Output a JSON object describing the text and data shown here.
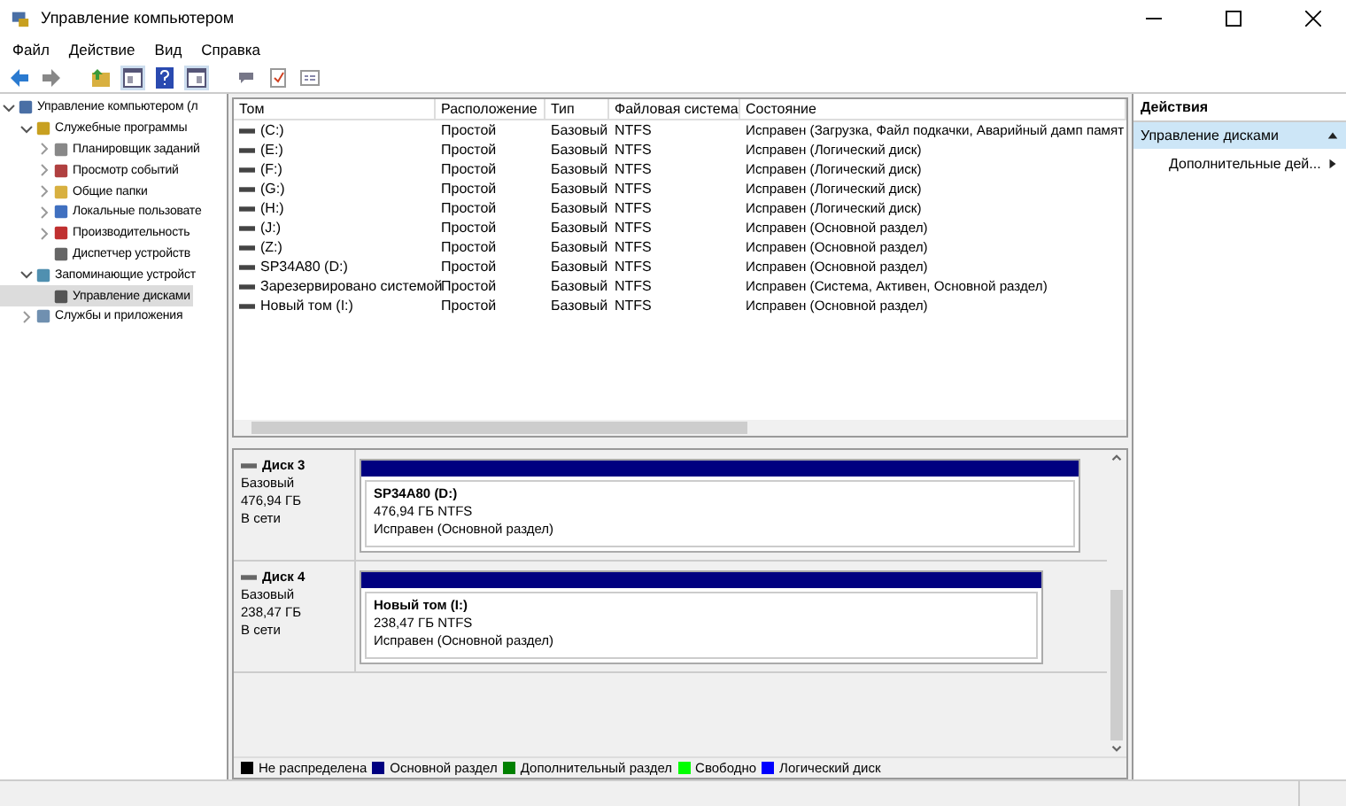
{
  "window": {
    "title": "Управление компьютером"
  },
  "menu": [
    "Файл",
    "Действие",
    "Вид",
    "Справка"
  ],
  "tree": [
    {
      "label": "Управление компьютером (л",
      "selected": false,
      "expanded": true,
      "children": [
        {
          "label": "Служебные программы",
          "selected": false,
          "expanded": true,
          "children": [
            {
              "label": "Планировщик заданий",
              "selected": false,
              "expanded": false
            },
            {
              "label": "Просмотр событий",
              "selected": false,
              "expanded": false
            },
            {
              "label": "Общие папки",
              "selected": false,
              "expanded": false
            },
            {
              "label": "Локальные пользовате",
              "selected": false,
              "expanded": false
            },
            {
              "label": "Производительность",
              "selected": false,
              "expanded": false
            },
            {
              "label": "Диспетчер устройств",
              "selected": false
            }
          ]
        },
        {
          "label": "Запоминающие устройст",
          "selected": false,
          "expanded": true,
          "children": [
            {
              "label": "Управление дисками",
              "selected": true
            }
          ]
        },
        {
          "label": "Службы и приложения",
          "selected": false,
          "expanded": false
        }
      ]
    }
  ],
  "table": {
    "columns": [
      "Том",
      "Расположение",
      "Тип",
      "Файловая система",
      "Состояние"
    ],
    "rows": [
      [
        "(C:)",
        "Простой",
        "Базовый",
        "NTFS",
        "Исправен (Загрузка, Файл подкачки, Аварийный дамп памят"
      ],
      [
        "(E:)",
        "Простой",
        "Базовый",
        "NTFS",
        "Исправен (Логический диск)"
      ],
      [
        "(F:)",
        "Простой",
        "Базовый",
        "NTFS",
        "Исправен (Логический диск)"
      ],
      [
        "(G:)",
        "Простой",
        "Базовый",
        "NTFS",
        "Исправен (Логический диск)"
      ],
      [
        "(H:)",
        "Простой",
        "Базовый",
        "NTFS",
        "Исправен (Логический диск)"
      ],
      [
        "(J:)",
        "Простой",
        "Базовый",
        "NTFS",
        "Исправен (Основной раздел)"
      ],
      [
        "(Z:)",
        "Простой",
        "Базовый",
        "NTFS",
        "Исправен (Основной раздел)"
      ],
      [
        "SP34A80 (D:)",
        "Простой",
        "Базовый",
        "NTFS",
        "Исправен (Основной раздел)"
      ],
      [
        "Зарезервировано системой",
        "Простой",
        "Базовый",
        "NTFS",
        "Исправен (Система, Активен, Основной раздел)"
      ],
      [
        "Новый том (I:)",
        "Простой",
        "Базовый",
        "NTFS",
        "Исправен (Основной раздел)"
      ]
    ]
  },
  "disks": [
    {
      "name": "Диск 3",
      "type": "Базовый",
      "size": "476,94 ГБ",
      "status": "В сети",
      "partition": {
        "label": "SP34A80  (D:)",
        "size_fs": "476,94 ГБ NTFS",
        "status": "Исправен (Основной раздел)",
        "color": "#000080"
      }
    },
    {
      "name": "Диск 4",
      "type": "Базовый",
      "size": "238,47 ГБ",
      "status": "В сети",
      "partition": {
        "label": "Новый том  (I:)",
        "size_fs": "238,47 ГБ NTFS",
        "status": "Исправен (Основной раздел)",
        "color": "#000080"
      }
    }
  ],
  "legend": [
    {
      "label": "Не распределена",
      "color": "#000000"
    },
    {
      "label": "Основной раздел",
      "color": "#000080"
    },
    {
      "label": "Дополнительный раздел",
      "color": "#008000"
    },
    {
      "label": "Свободно",
      "color": "#00ff00"
    },
    {
      "label": "Логический диск",
      "color": "#0000ff"
    }
  ],
  "actions": {
    "title": "Действия",
    "section": {
      "label": "Управление дисками",
      "expanded": true
    },
    "items": [
      "Дополнительные дей..."
    ]
  }
}
